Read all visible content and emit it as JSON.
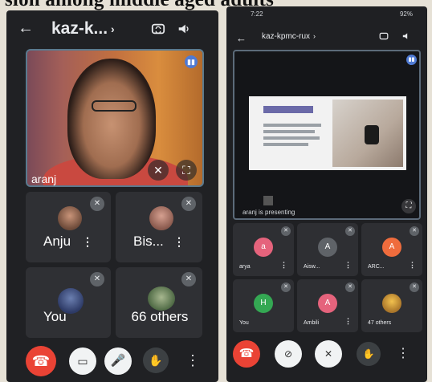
{
  "document": {
    "header_text": "sion among middle aged adults"
  },
  "left_phone": {
    "title": "kaz-k...",
    "main_speaker": {
      "name": "aranj"
    },
    "tiles": [
      {
        "name": "Anju",
        "initial": ""
      },
      {
        "name": "Bis...",
        "initial": ""
      },
      {
        "name": "You",
        "initial": ""
      },
      {
        "name": "66 others",
        "initial": ""
      }
    ],
    "icons": {
      "back": "arrow-left-icon",
      "switch_camera": "switch-camera-icon",
      "speaker": "speaker-icon",
      "pin": "pin-icon",
      "fullscreen": "fullscreen-icon",
      "mic_off": "mic-off-icon",
      "more": "more-vert-icon"
    },
    "controls": [
      {
        "name": "end-call",
        "color": "#ea4335"
      },
      {
        "name": "camera",
        "color": "#f1f3f4"
      },
      {
        "name": "microphone",
        "color": "#f1f3f4"
      },
      {
        "name": "raise-hand",
        "color": "#3c4043"
      },
      {
        "name": "more-options",
        "color": "#3c4043"
      }
    ]
  },
  "right_phone": {
    "status_time": "7:22",
    "status_battery": "92%",
    "title": "kaz-kpmc-rux",
    "presenting_label": "aranj is presenting",
    "tiles": [
      {
        "name": "arya",
        "initial": "a",
        "color": "#e5637c"
      },
      {
        "name": "Aisw...",
        "initial": "A",
        "color": "#5f6368"
      },
      {
        "name": "ARC...",
        "initial": "A",
        "color": "#ef6c3d"
      },
      {
        "name": "You",
        "initial": "H",
        "color": "#34a853"
      },
      {
        "name": "Ambili",
        "initial": "A",
        "color": "#e5637c"
      },
      {
        "name": "47 others",
        "initial": "",
        "color": "#5f6368"
      }
    ],
    "controls": [
      {
        "name": "end-call",
        "color": "#ea4335"
      },
      {
        "name": "camera-off",
        "color": "#f1f3f4"
      },
      {
        "name": "microphone-off",
        "color": "#f1f3f4"
      },
      {
        "name": "raise-hand",
        "color": "#3c4043"
      },
      {
        "name": "more-options",
        "color": "#3c4043"
      }
    ]
  },
  "accent_colors": {
    "end_call": "#ea4335",
    "active_speaker": "#4f7ad3",
    "tile_bg": "#2f3034"
  }
}
